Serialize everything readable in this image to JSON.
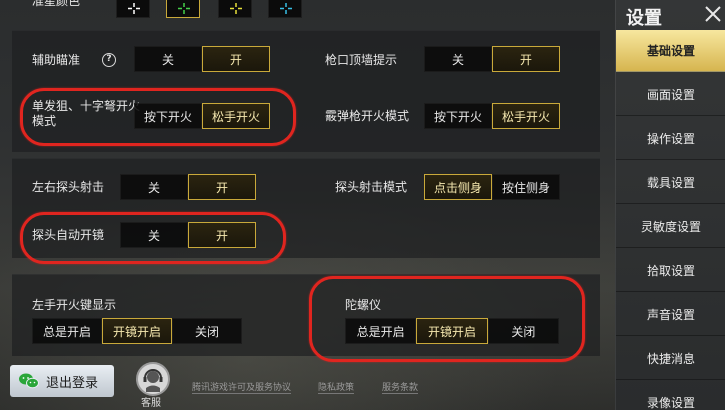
{
  "crosshair_color": {
    "label": "准星颜色",
    "swatch_colors": [
      "#ffffff",
      "#45d04a",
      "#e8e03a",
      "#38c0e6"
    ]
  },
  "aim_assist": {
    "label": "辅助瞄准",
    "options": [
      "关",
      "开"
    ],
    "selected": 1
  },
  "muzzle_wall_hint": {
    "label": "枪口顶墙提示",
    "options": [
      "关",
      "开"
    ],
    "selected": 1
  },
  "single_shot_fire": {
    "label": "单发狙、十字弩开火模式",
    "options": [
      "按下开火",
      "松手开火"
    ],
    "selected": 1
  },
  "shotgun_fire": {
    "label": "霰弹枪开火模式",
    "options": [
      "按下开火",
      "松手开火"
    ],
    "selected": 1
  },
  "lean_fire": {
    "label": "左右探头射击",
    "options": [
      "关",
      "开"
    ],
    "selected": 1
  },
  "lean_mode": {
    "label": "探头射击模式",
    "options": [
      "点击侧身",
      "按住侧身"
    ],
    "selected": 0
  },
  "lean_auto_scope": {
    "label": "探头自动开镜",
    "options": [
      "关",
      "开"
    ],
    "selected": 1
  },
  "left_fire_display": {
    "label": "左手开火键显示",
    "options": [
      "总是开启",
      "开镜开启",
      "关闭"
    ],
    "selected": 1
  },
  "gyroscope": {
    "label": "陀螺仪",
    "options": [
      "总是开启",
      "开镜开启",
      "关闭"
    ],
    "selected": 1
  },
  "sidebar": {
    "title": "设置",
    "items": [
      "基础设置",
      "画面设置",
      "操作设置",
      "载具设置",
      "灵敏度设置",
      "拾取设置",
      "声音设置",
      "快捷消息",
      "录像设置"
    ],
    "active": 0
  },
  "footer": {
    "logout": "退出登录",
    "service": "客服",
    "links": [
      "腾讯游戏许可及服务协议",
      "隐私政策",
      "服务条款"
    ]
  },
  "colors": {
    "accent": "#c9a93a",
    "highlight_ring": "#e0251f",
    "active_tab": "#e8cf74"
  }
}
